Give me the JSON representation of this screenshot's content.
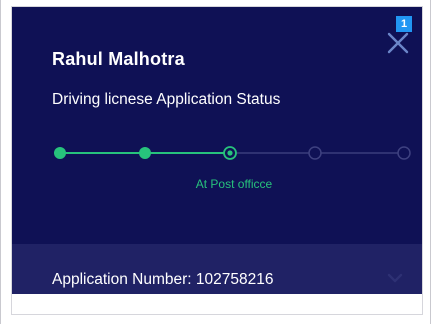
{
  "notification": {
    "badge_count": "1",
    "close_icon": "close-icon"
  },
  "status_card": {
    "name": "Rahul Malhotra",
    "subtitle": "Driving licnese Application Status",
    "current_step_label": "At Post officce",
    "steps_total": 5,
    "steps_completed": 2,
    "current_step_index": 3,
    "accent_color": "#27c27c"
  },
  "footer": {
    "application_number": "Application Number: 102758216",
    "expand_icon": "chevron-down-icon"
  },
  "colors": {
    "header_bg": "#0f1155",
    "footer_bg": "#202265",
    "badge_bg": "#2196f3"
  }
}
